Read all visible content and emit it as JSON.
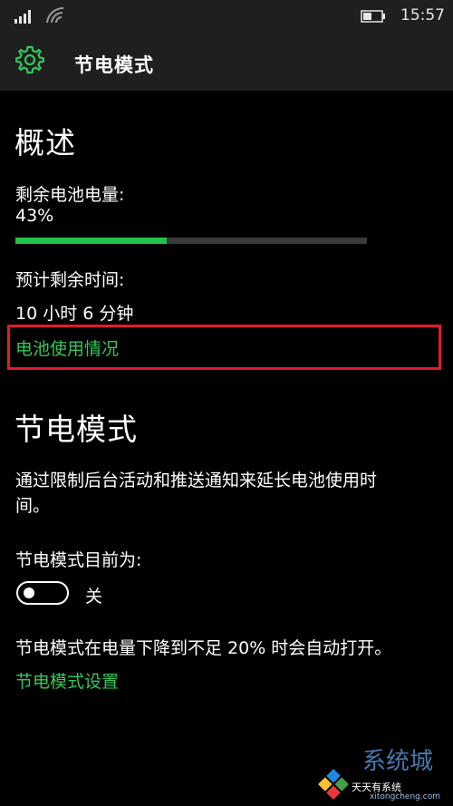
{
  "status_bar": {
    "time": "15:57",
    "icons": [
      "signal-icon",
      "wifi-icon",
      "battery-icon"
    ]
  },
  "app_bar": {
    "icon": "gear-icon",
    "title": "节电模式"
  },
  "overview": {
    "heading": "概述",
    "battery_label": "剩余电池电量:",
    "battery_value": "43%",
    "battery_level": 0.43,
    "remaining_label": "预计剩余时间:",
    "remaining_value": "10 小时 6 分钟",
    "usage_link": "电池使用情况"
  },
  "saver": {
    "heading": "节电模式",
    "description_line1": "通过限制后台活动和推送通知来延长电池使用时",
    "description_line2": "间。",
    "status_label": "节电模式目前为:",
    "toggle_state": "关",
    "auto_note": "节电模式在电量下降到不足 20% 时会自动打开。",
    "settings_link": "节电模式设置"
  },
  "watermark": {
    "line1": "天天有系统",
    "line2": "xitongcheng.com"
  },
  "colors": {
    "accent": "#34c759",
    "progress_fill": "#22c34a",
    "highlight_border": "#e01a2c",
    "bar_background": "#1f1f1f"
  }
}
